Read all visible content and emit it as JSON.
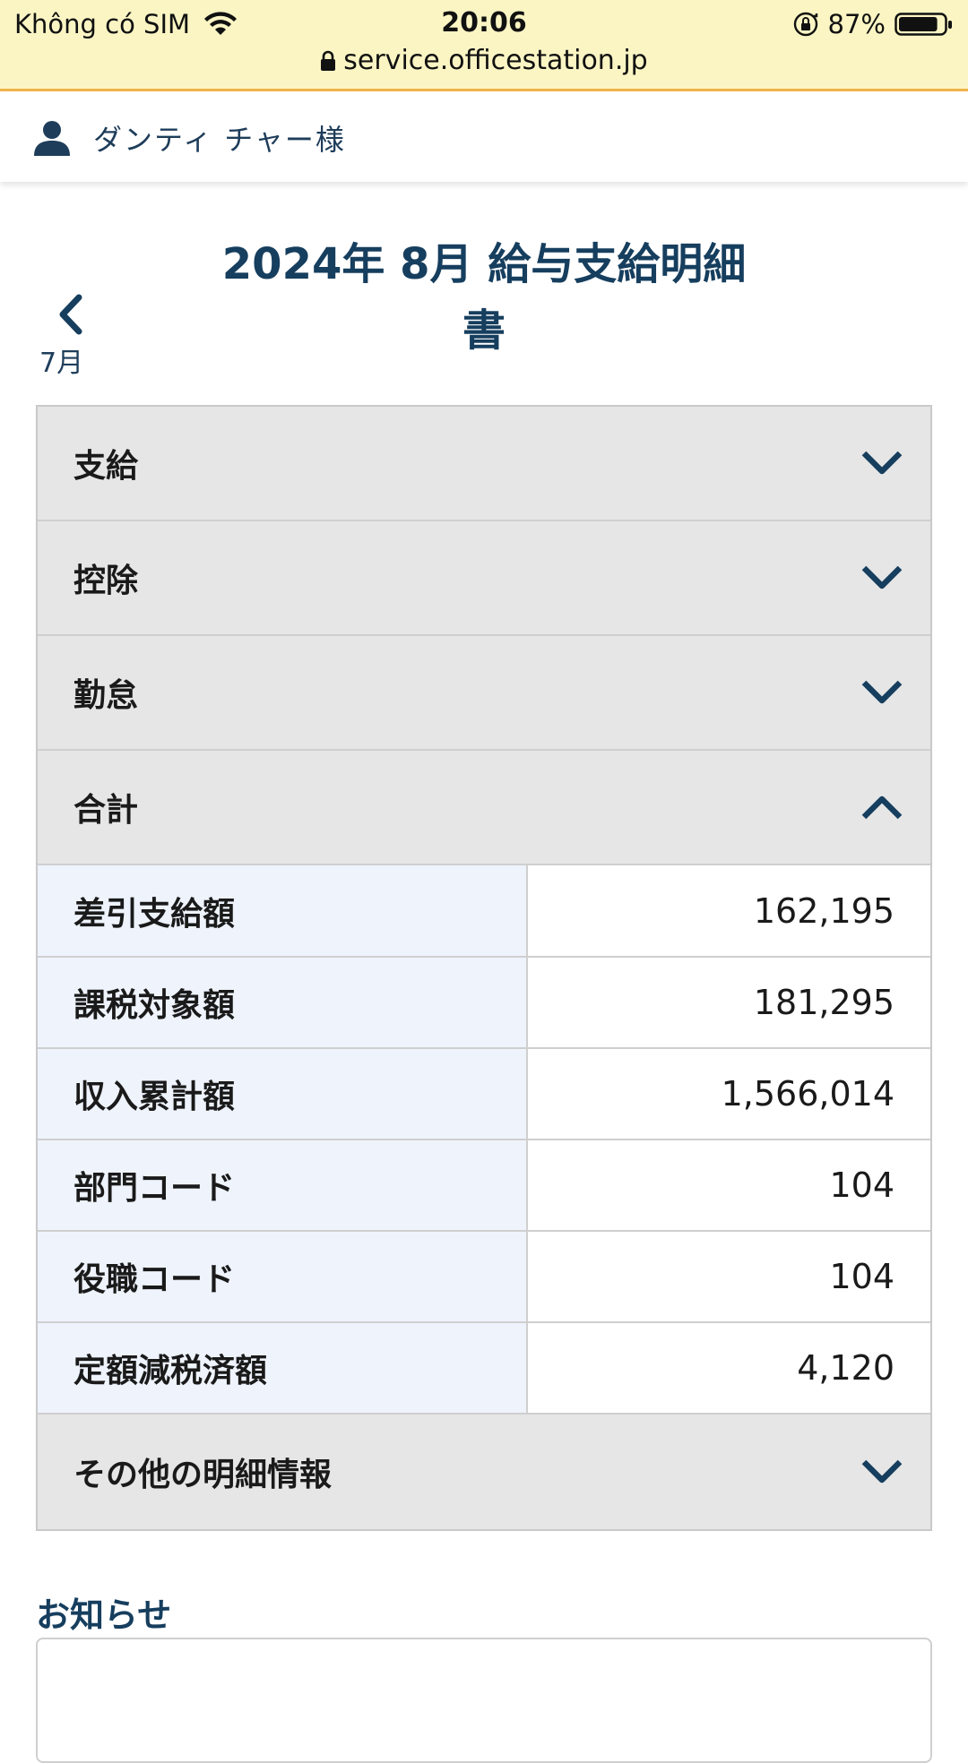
{
  "status_bar": {
    "carrier": "Không có SIM",
    "time": "20:06",
    "battery": "87%",
    "battery_level": 0.87,
    "url": "service.officestation.jp"
  },
  "user": {
    "name": "ダンティ チャー様"
  },
  "title": {
    "line1": "2024年 8月 給与支給明細",
    "line2": "書"
  },
  "nav": {
    "prev_label": "7月"
  },
  "sections": {
    "payment": "支給",
    "deduction": "控除",
    "attendance": "勤怠",
    "total": "合計",
    "other": "その他の明細情報"
  },
  "totals": [
    {
      "label": "差引支給額",
      "value": "162,195"
    },
    {
      "label": "課税対象額",
      "value": "181,295"
    },
    {
      "label": "収入累計額",
      "value": "1,566,014"
    },
    {
      "label": "部門コード",
      "value": "104"
    },
    {
      "label": "役職コード",
      "value": "104"
    },
    {
      "label": "定額減税済額",
      "value": "4,120"
    }
  ],
  "notice": {
    "title": "お知らせ"
  },
  "colors": {
    "url_bar_bg": "#fbf5c4",
    "url_bar_border": "#f0b44a",
    "navy": "#163e5e",
    "header_gray": "#e6e6e6",
    "label_cell_blue": "#eef3fc"
  }
}
